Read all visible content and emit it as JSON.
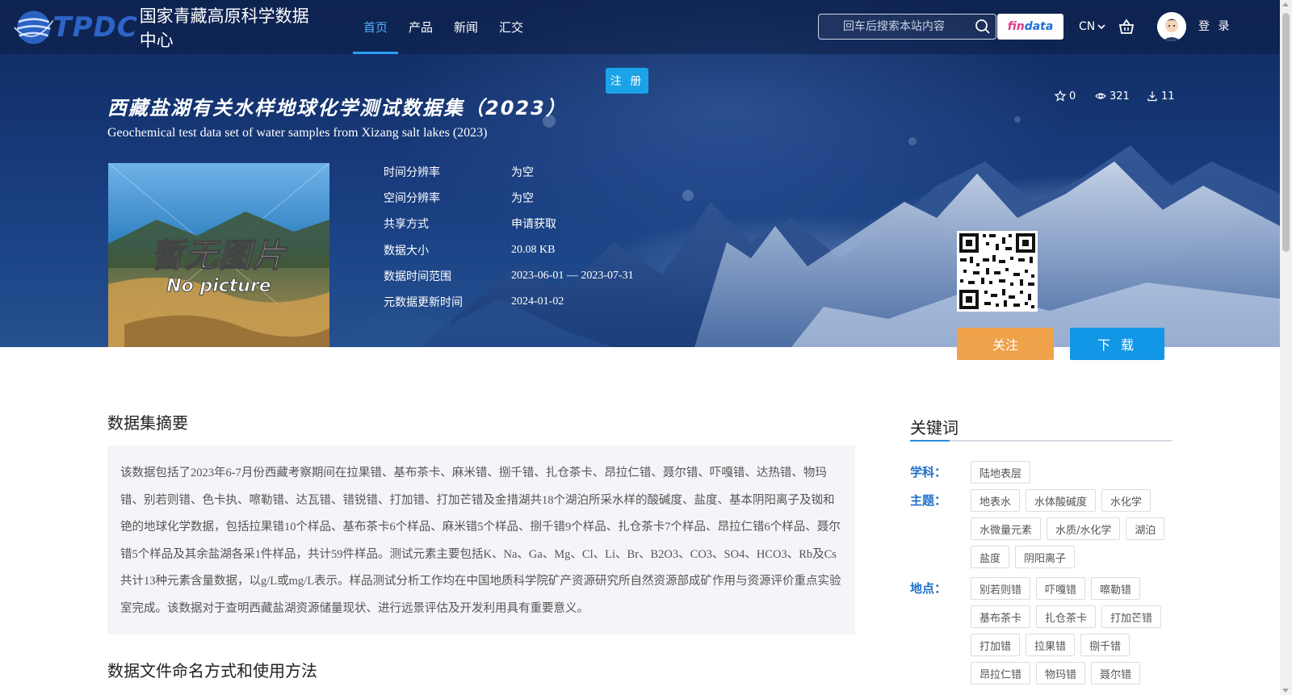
{
  "brand": {
    "logo_text": "TPDC",
    "site_name": "国家青藏高原科学数据中心"
  },
  "nav": {
    "items": [
      {
        "label": "首页",
        "active": true
      },
      {
        "label": "产品",
        "active": false
      },
      {
        "label": "新闻",
        "active": false
      },
      {
        "label": "汇交",
        "active": false
      }
    ]
  },
  "search": {
    "placeholder": "回车后搜索本站内容"
  },
  "header_actions": {
    "findata_a": "fin",
    "findata_b": "data",
    "language": "CN",
    "login_label": "登 录",
    "register_label": "注 册"
  },
  "dataset": {
    "title_cn": "西藏盐湖有关水样地球化学测试数据集（2023）",
    "title_en": "Geochemical test data set of water samples from Xizang salt lakes (2023)",
    "stats": {
      "favorites": "0",
      "views": "321",
      "downloads": "11"
    },
    "thumbnail": {
      "text_cn": "暂无图片",
      "text_en": "No picture"
    },
    "metadata": [
      {
        "label": "时间分辨率",
        "value": "为空"
      },
      {
        "label": "空间分辨率",
        "value": "为空"
      },
      {
        "label": "共享方式",
        "value": "申请获取"
      },
      {
        "label": "数据大小",
        "value": "20.08 KB"
      },
      {
        "label": "数据时间范围",
        "value": "2023-06-01 — 2023-07-31"
      },
      {
        "label": "元数据更新时间",
        "value": "2024-01-02"
      }
    ],
    "follow_label": "关注",
    "download_label": "下 载"
  },
  "abstract": {
    "heading": "数据集摘要",
    "text": "该数据包括了2023年6-7月份西藏考察期间在拉果错、基布茶卡、麻米错、捌千错、扎仓茶卡、昂拉仁错、聂尔错、吓嘎错、达热错、物玛错、别若则错、色卡执、嚓勒错、达瓦错、错锐错、打加错、打加芒错及金措湖共18个湖泊所采水样的酸碱度、盐度、基本阴阳离子及铷和铯的地球化学数据，包括拉果错10个样品、基布茶卡6个样品、麻米错5个样品、捌千错9个样品、扎仓茶卡7个样品、昂拉仁错6个样品、聂尔错5个样品及其余盐湖各采1件样品，共计59件样品。测试元素主要包括K、Na、Ga、Mg、Cl、Li、Br、B2O3、CO3、SO4、HCO3、Rb及Cs共计13种元素含量数据，以g/L或mg/L表示。样品测试分析工作均在中国地质科学院矿产资源研究所自然资源部成矿作用与资源评价重点实验室完成。该数据对于查明西藏盐湖资源储量现状、进行远景评估及开发利用具有重要意义。"
  },
  "file_naming": {
    "heading": "数据文件命名方式和使用方法"
  },
  "keywords": {
    "heading": "关键词",
    "subject_label": "学科：",
    "subject_tags": [
      "陆地表层"
    ],
    "theme_label": "主题：",
    "theme_tags": [
      "地表水",
      "水体酸碱度",
      "水化学",
      "水微量元素",
      "水质/水化学",
      "湖泊",
      "盐度",
      "阴阳离子"
    ],
    "place_label": "地点：",
    "place_tags": [
      "别若则错",
      "吓嘎错",
      "嚓勒错",
      "基布茶卡",
      "扎仓茶卡",
      "打加芒错",
      "打加错",
      "拉果错",
      "捌千错",
      "昂拉仁错",
      "物玛错",
      "聂尔错"
    ]
  }
}
